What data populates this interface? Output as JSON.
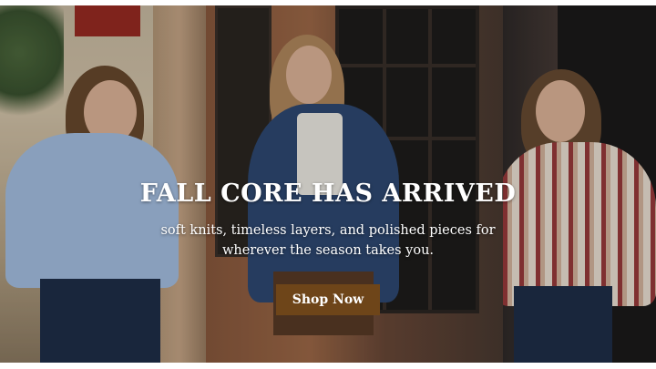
{
  "hero": {
    "headline": "FALL CORE HAS ARRIVED",
    "subline_1": "soft knits, timeless layers, and polished pieces for",
    "subline_2": "wherever the season takes you.",
    "cta_label": "Shop Now"
  },
  "colors": {
    "cta_background": "#6e4519",
    "headline_text": "#ffffff"
  },
  "images": [
    "model-in-light-blue-cardigan",
    "model-in-floral-denim-jacket",
    "model-in-striped-sweater"
  ]
}
